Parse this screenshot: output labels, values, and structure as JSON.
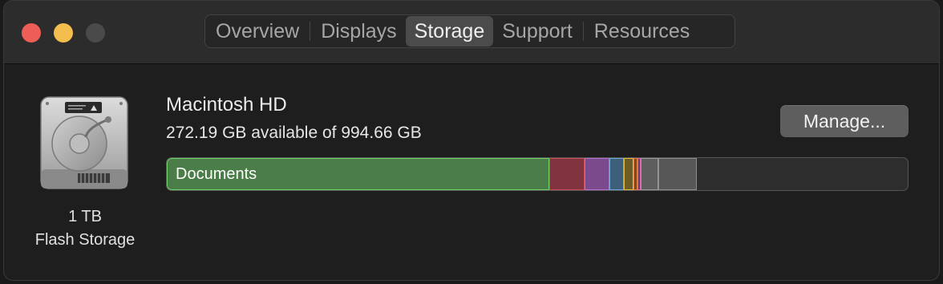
{
  "tabs": [
    "Overview",
    "Displays",
    "Storage",
    "Support",
    "Resources"
  ],
  "disk": {
    "capacity_label": "1 TB",
    "type_label": "Flash Storage",
    "icon": "hard-drive-icon"
  },
  "volume": {
    "name": "Macintosh HD",
    "available_text": "272.19 GB available of 994.66 GB"
  },
  "manage_label": "Manage...",
  "storage_segments": [
    {
      "name": "documents",
      "label": "Documents",
      "fraction": 0.5165,
      "fill": "#4a7d47",
      "border": "#6fd466"
    },
    {
      "name": "red",
      "label": "",
      "fraction": 0.0477,
      "fill": "#80343f",
      "border": "#c94b57"
    },
    {
      "name": "purple",
      "label": "",
      "fraction": 0.0337,
      "fill": "#7a4a8c",
      "border": "#b46fd0"
    },
    {
      "name": "blue",
      "label": "",
      "fraction": 0.0195,
      "fill": "#3e5f7a",
      "border": "#6ea7d8"
    },
    {
      "name": "yellow",
      "label": "",
      "fraction": 0.013,
      "fill": "#6e5c26",
      "border": "#e2bd3e"
    },
    {
      "name": "orange",
      "label": "",
      "fraction": 0.0054,
      "fill": "#7a4a2a",
      "border": "#e67e3f"
    },
    {
      "name": "pink",
      "label": "",
      "fraction": 0.0043,
      "fill": "#6f3e5c",
      "border": "#d968b0"
    },
    {
      "name": "light-gray",
      "label": "",
      "fraction": 0.0238,
      "fill": "#5e5e5e",
      "border": "#9a9a9a"
    },
    {
      "name": "gray",
      "label": "",
      "fraction": 0.052,
      "fill": "#575757",
      "border": "#8c8c8c"
    }
  ]
}
